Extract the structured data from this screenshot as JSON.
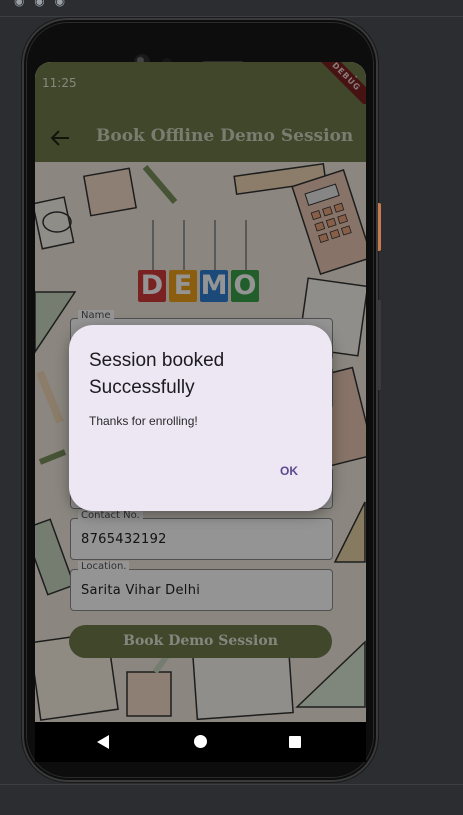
{
  "device": {
    "time": "11:25",
    "debug_banner": "DEBUG"
  },
  "appbar": {
    "title": "Book Offline Demo Session",
    "back_icon": "arrow-left-icon"
  },
  "banner": {
    "letters": [
      "D",
      "E",
      "M",
      "O"
    ],
    "colors": [
      "#d23b3b",
      "#f0a21b",
      "#2f7fd0",
      "#3aa34a"
    ]
  },
  "form": {
    "name_label": "Name",
    "contact_label": "Contact No.",
    "contact_value": "8765432192",
    "location_label": "Location.",
    "location_value": "Sarita Vihar Delhi",
    "submit_label": "Book Demo Session"
  },
  "dialog": {
    "title": "Session booked Successfully",
    "message": "Thanks for enrolling!",
    "ok_label": "OK"
  },
  "nav": {
    "back_icon": "triangle-back-icon",
    "home_icon": "circle-home-icon",
    "recents_icon": "square-recents-icon"
  },
  "colors": {
    "primary": "#6f7a4a",
    "dialog_bg": "#ede6f3",
    "dialog_action": "#5b4a8f"
  }
}
